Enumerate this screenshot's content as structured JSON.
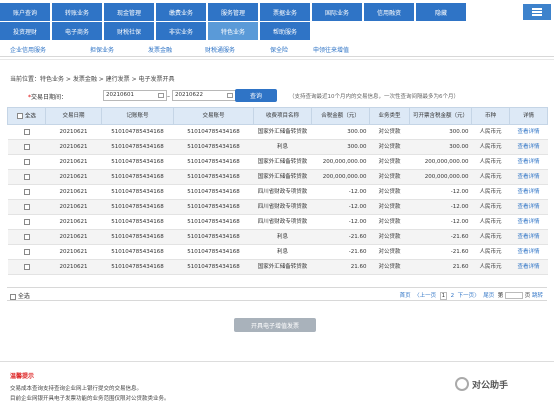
{
  "topnav": {
    "row1": [
      "账户查询",
      "转账业务",
      "现金管理",
      "缴费业务",
      "服务管理",
      "票据业务",
      "国际业务",
      "信用融资",
      "隐藏"
    ],
    "row2": [
      "投资理财",
      "电子商务",
      "财税社保",
      "非实业务",
      "特色业务",
      "帮助服务"
    ]
  },
  "subnav": [
    "企业信用服务",
    "担保业务",
    "发票金融",
    "财税通服务",
    "保全险",
    "申领往来增值"
  ],
  "breadcrumb": "当前位置：特色业务 > 发票金融 > 建行发票 > 电子发票开具",
  "filter": {
    "label": "交易日期间：",
    "start_date": "20210601",
    "end_date": "20210622",
    "query_button": "查询",
    "note": "（支持查询最近10个月内的交易信息，一次性查询间隔最多为6个月）"
  },
  "table": {
    "headers": [
      "全选",
      "交易日期",
      "记账账号",
      "交易账号",
      "收费项目名称",
      "合税金额（元）",
      "业务类型",
      "可开票含税金额（元）",
      "币种",
      "详情"
    ],
    "rows": [
      [
        "20210621",
        "510104785434168",
        "510104785434168",
        "国家外汇储备转贷款",
        "300.00",
        "对公贷款",
        "300.00",
        "人民币元",
        "查看详情"
      ],
      [
        "20210621",
        "510104785434168",
        "510104785434168",
        "利息",
        "300.00",
        "对公贷款",
        "300.00",
        "人民币元",
        "查看详情"
      ],
      [
        "20210621",
        "510104785434168",
        "510104785434168",
        "国家外汇储备转贷款",
        "200,000,000.00",
        "对公贷款",
        "200,000,000.00",
        "人民币元",
        "查看详情"
      ],
      [
        "20210621",
        "510104785434168",
        "510104785434168",
        "国家外汇储备转贷款",
        "200,000,000.00",
        "对公贷款",
        "200,000,000.00",
        "人民币元",
        "查看详情"
      ],
      [
        "20210621",
        "510104785434168",
        "510104785434168",
        "四川省财政专项贷款",
        "-12.00",
        "对公贷款",
        "-12.00",
        "人民币元",
        "查看详情"
      ],
      [
        "20210621",
        "510104785434168",
        "510104785434168",
        "四川省财政专项贷款",
        "-12.00",
        "对公贷款",
        "-12.00",
        "人民币元",
        "查看详情"
      ],
      [
        "20210621",
        "510104785434168",
        "510104785434168",
        "四川省财政专项贷款",
        "-12.00",
        "对公贷款",
        "-12.00",
        "人民币元",
        "查看详情"
      ],
      [
        "20210621",
        "510104785434168",
        "510104785434168",
        "利息",
        "-21.60",
        "对公贷款",
        "-21.60",
        "人民币元",
        "查看详情"
      ],
      [
        "20210621",
        "510104785434168",
        "510104785434168",
        "利息",
        "-21.60",
        "对公贷款",
        "-21.60",
        "人民币元",
        "查看详情"
      ],
      [
        "20210621",
        "510104785434168",
        "510104785434168",
        "国家外汇储备转贷款",
        "21.60",
        "对公贷款",
        "21.60",
        "人民币元",
        "查看详情"
      ]
    ]
  },
  "footer": {
    "select_all": "全选",
    "first": "首页",
    "prev": "〈上一页",
    "page1": "1",
    "page2": "2",
    "next": "下一页〉",
    "last": "尾页",
    "page_text": "第",
    "page_suffix": "页",
    "go": "跳转"
  },
  "issue_button": "开具电子增值发票",
  "tips": {
    "title": "温馨提示",
    "line1": "交易成本查询支持查询企业网上银行提交的交易信息。",
    "line2": "目前企业网银开具电子发票功能的业务范围仅限对公贷款类业务。"
  },
  "watermark": "对公助手"
}
